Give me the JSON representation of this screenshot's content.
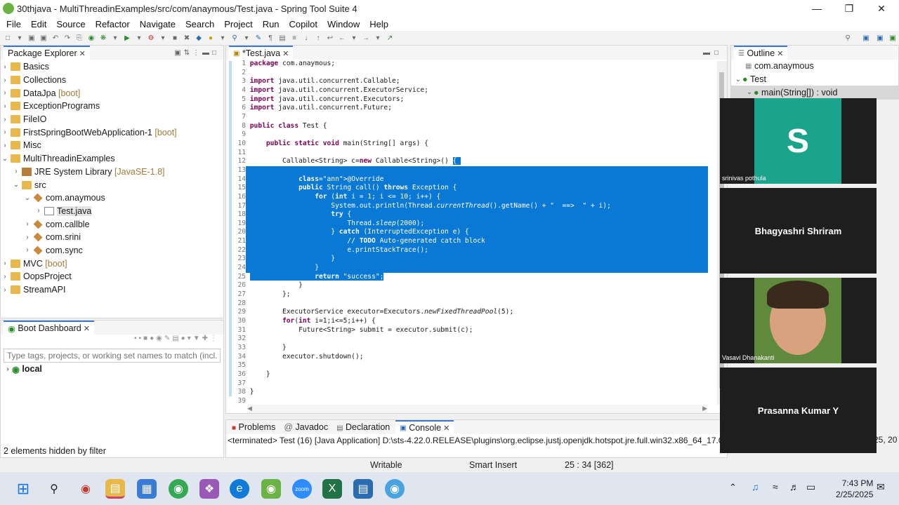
{
  "window": {
    "title": "30thjava - MultiThreadinExamples/src/com/anaymous/Test.java - Spring Tool Suite 4"
  },
  "menu": [
    "File",
    "Edit",
    "Source",
    "Refactor",
    "Navigate",
    "Search",
    "Project",
    "Run",
    "Copilot",
    "Window",
    "Help"
  ],
  "package_explorer": {
    "title": "Package Explorer",
    "items": [
      {
        "label": "Basics",
        "deco": ""
      },
      {
        "label": "Collections",
        "deco": ""
      },
      {
        "label": "DataJpa",
        "deco": "[boot]"
      },
      {
        "label": "ExceptionPrograms",
        "deco": ""
      },
      {
        "label": "FileIO",
        "deco": ""
      },
      {
        "label": "FirstSpringBootWebApplication-1",
        "deco": "[boot]"
      },
      {
        "label": "Misc",
        "deco": ""
      },
      {
        "label": "MultiThreadinExamples",
        "deco": ""
      },
      {
        "label": "JRE System Library",
        "deco": "[JavaSE-1.8]"
      },
      {
        "label": "src",
        "deco": ""
      },
      {
        "label": "com.anaymous",
        "deco": ""
      },
      {
        "label": "Test.java",
        "deco": ""
      },
      {
        "label": "com.callble",
        "deco": ""
      },
      {
        "label": "com.srini",
        "deco": ""
      },
      {
        "label": "com.sync",
        "deco": ""
      },
      {
        "label": "MVC",
        "deco": "[boot]"
      },
      {
        "label": "OopsProject",
        "deco": ""
      },
      {
        "label": "StreamAPI",
        "deco": ""
      }
    ]
  },
  "boot_dashboard": {
    "title": "Boot Dashboard",
    "filter_placeholder": "Type tags, projects, or working set names to match (incl. *",
    "local": "local",
    "hidden": "2 elements hidden by filter"
  },
  "editor": {
    "tab": "*Test.java"
  },
  "code_lines": [
    "package com.anaymous;",
    "",
    "import java.util.concurrent.Callable;",
    "import java.util.concurrent.ExecutorService;",
    "import java.util.concurrent.Executors;",
    "import java.util.concurrent.Future;",
    "",
    "public class Test {",
    "",
    "    public static void main(String[] args) {",
    "",
    "        Callable<String> c=new Callable<String>() {",
    "",
    "            @Override",
    "            public String call() throws Exception {",
    "                for (int i = 1; i <= 10; i++) {",
    "                    System.out.println(Thread.currentThread().getName() + \"  ==>  \" + i);",
    "                    try {",
    "                        Thread.sleep(2000);",
    "                    } catch (InterruptedException e) {",
    "                        // TODO Auto-generated catch block",
    "                        e.printStackTrace();",
    "                    }",
    "                }",
    "                return \"success\";",
    "            }",
    "        };",
    "",
    "        ExecutorService executor=Executors.newFixedThreadPool(5);",
    "        for(int i=1;i<=5;i++) {",
    "            Future<String> submit = executor.submit(c);",
    "",
    "        }",
    "        executor.shutdown();",
    "",
    "    }",
    "",
    "}",
    ""
  ],
  "outline": {
    "title": "Outline",
    "package": "com.anaymous",
    "class": "Test",
    "method": "main(String[]) : void"
  },
  "bottom": {
    "tabs": [
      "Problems",
      "Javadoc",
      "Declaration",
      "Console"
    ],
    "console_line": "<terminated> Test (16) [Java Application] D:\\sts-4.22.0.RELEASE\\plugins\\org.eclipse.justj.openjdk.hotspot.jre.full.win32.x86_64_17.0.10",
    "console_tail": "25, 20"
  },
  "status": {
    "writable": "Writable",
    "insert": "Smart Insert",
    "position": "25 : 34 [362]"
  },
  "participants": [
    {
      "initial": "S",
      "name": "srinivas pothula"
    },
    {
      "name": "Bhagyashri Shriram"
    },
    {
      "name": "Vasavi Dhanakanti"
    },
    {
      "name": "Prasanna Kumar Y"
    }
  ],
  "clock": {
    "time": "7:43 PM",
    "date": "2/25/2025"
  },
  "colors": {
    "selection": "#0a79d6",
    "avatar_bg": "#1aa48b",
    "keyword": "#7f0055"
  }
}
